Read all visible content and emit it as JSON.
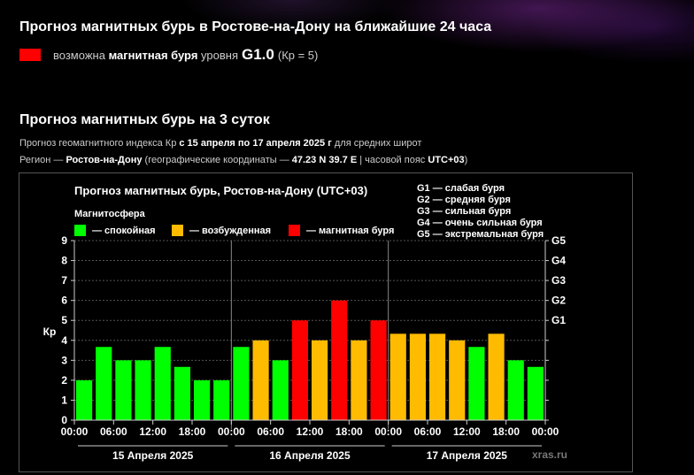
{
  "header": {
    "title": "Прогноз магнитных бурь в Ростове-на-Дону на ближайшие 24 часа",
    "now_prefix": "возможна",
    "now_event": "магнитная буря",
    "now_mid": "уровня",
    "now_level": "G1.0",
    "now_kp": "(Кр = 5)",
    "swatch_color": "#ff0000"
  },
  "section": {
    "title": "Прогноз магнитных бурь на 3 суток",
    "line1_pre": "Прогноз геомагнитного индекса Кр",
    "line1_range": "с 15 апреля по 17 апреля 2025 г",
    "line1_post": "для средних широт",
    "line2_pre": "Регион —",
    "line2_region": "Ростов-на-Дону",
    "line2_mid": "(географические координаты —",
    "line2_coords": "47.23 N 39.7 E",
    "line2_tz_pre": "| часовой пояс",
    "line2_tz": "UTC+03",
    "line2_post": ")"
  },
  "chart_data": {
    "type": "bar",
    "title": "Прогноз магнитных бурь, Ростов-на-Дону (UTC+03)",
    "legend_title": "Магнитосфера",
    "legend": [
      {
        "label": "— спокойная",
        "color": "#00ff00"
      },
      {
        "label": "— возбужденная",
        "color": "#ffbb00"
      },
      {
        "label": "— магнитная буря",
        "color": "#ff0000"
      }
    ],
    "g_legend": [
      "G1 — слабая буря",
      "G2 — средняя буря",
      "G3 — сильная буря",
      "G4 — очень сильная буря",
      "G5 — экстремальная буря"
    ],
    "ylabel": "Кр",
    "ylim": [
      0,
      9
    ],
    "yticks": [
      "0",
      "1",
      "2",
      "3",
      "4",
      "5",
      "6",
      "7",
      "8",
      "9"
    ],
    "right_ticks": [
      {
        "label": "G1",
        "kp": 5
      },
      {
        "label": "G2",
        "kp": 6
      },
      {
        "label": "G3",
        "kp": 7
      },
      {
        "label": "G4",
        "kp": 8
      },
      {
        "label": "G5",
        "kp": 9
      }
    ],
    "x_hours": [
      "00:00",
      "06:00",
      "12:00",
      "18:00",
      "00:00",
      "06:00",
      "12:00",
      "18:00",
      "00:00",
      "06:00",
      "12:00",
      "18:00",
      "00:00"
    ],
    "days": [
      "15 Апреля 2025",
      "16 Апреля 2025",
      "17 Апреля 2025"
    ],
    "values": [
      2.0,
      3.67,
      3.0,
      3.0,
      3.67,
      2.67,
      2.0,
      2.0,
      3.67,
      4.0,
      3.0,
      5.0,
      4.0,
      6.0,
      4.0,
      5.0,
      4.33,
      4.33,
      4.33,
      4.0,
      3.67,
      4.33,
      3.0,
      2.67
    ],
    "colors": {
      "quiet": "#00ff00",
      "active": "#ffbb00",
      "storm": "#ff0000"
    },
    "watermark": "xras.ru"
  }
}
